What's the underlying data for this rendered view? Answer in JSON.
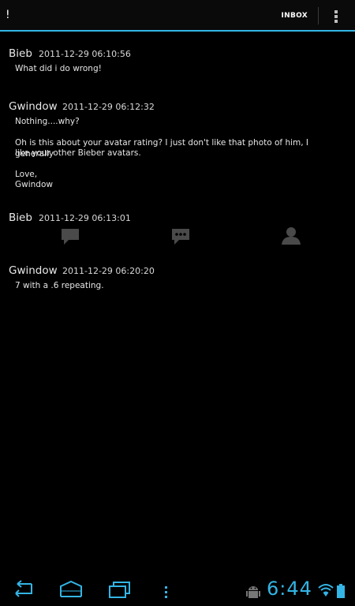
{
  "actionbar": {
    "title": "!",
    "inbox_label": "INBOX",
    "overflow_icon": "overflow-menu-icon"
  },
  "messages": [
    {
      "author": "Bieb",
      "timestamp": "2011-12-29 06:10:56",
      "body": [
        "What did i do wrong!"
      ]
    },
    {
      "author": "Gwindow",
      "timestamp": "2011-12-29 06:12:32",
      "body": [
        "Nothing....why?",
        "Oh is this about your avatar rating? I just don't like that photo of him, I generally",
        "like your other Bieber avatars.",
        "Love,",
        "Gwindow"
      ]
    },
    {
      "author": "Bieb",
      "timestamp": "2011-12-29 06:13:01",
      "actions": [
        "reply-icon",
        "reply-all-icon",
        "contact-icon"
      ]
    },
    {
      "author": "Gwindow",
      "timestamp": "2011-12-29 06:20:20",
      "body": [
        "7 with a .6 repeating."
      ]
    }
  ],
  "system_bar": {
    "back_icon": "back-icon",
    "home_icon": "home-icon",
    "recents_icon": "recent-apps-icon",
    "menu_icon": "menu-icon",
    "debug_icon": "android-debug-icon",
    "time": "6:44",
    "wifi_icon": "wifi-icon",
    "battery_icon": "battery-icon"
  },
  "colors": {
    "accent": "#33b5e5",
    "background": "#000000",
    "icon_gray": "#4a4a4a"
  }
}
